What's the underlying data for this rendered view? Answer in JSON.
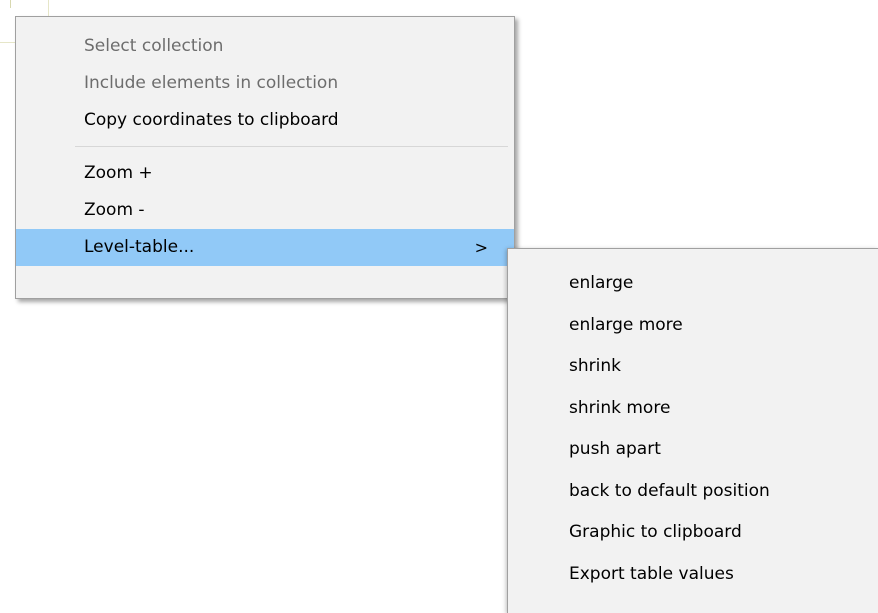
{
  "context_menu": {
    "items_top": [
      {
        "label": "Select collection",
        "enabled": false
      },
      {
        "label": "Include elements in collection",
        "enabled": false
      },
      {
        "label": "Copy coordinates to clipboard",
        "enabled": true
      }
    ],
    "items_bottom": [
      {
        "label": "Zoom +",
        "enabled": true
      },
      {
        "label": "Zoom -",
        "enabled": true
      },
      {
        "label": "Level-table...",
        "enabled": true,
        "highlighted": true,
        "submenu_indicator": ">"
      }
    ]
  },
  "submenu": {
    "items": [
      {
        "label": "enlarge"
      },
      {
        "label": "enlarge more"
      },
      {
        "label": "shrink"
      },
      {
        "label": "shrink more"
      },
      {
        "label": "push apart"
      },
      {
        "label": "back to default position"
      },
      {
        "label": "Graphic to clipboard"
      },
      {
        "label": "Export table values"
      }
    ]
  },
  "colors": {
    "menu_background": "#f2f2f2",
    "highlight": "#91c9f7",
    "disabled_text": "#6d6d6d"
  }
}
